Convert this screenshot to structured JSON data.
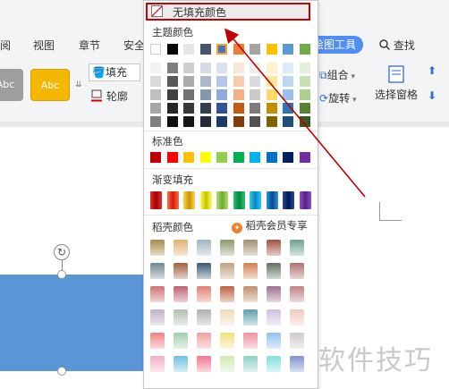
{
  "ribbon": {
    "tabs": [
      "阅",
      "视图",
      "章节",
      "安全"
    ],
    "tool_tab": "绘图工具",
    "search": "查找",
    "style_swatches": [
      {
        "label": "Abc",
        "color": "#9e9e9e"
      },
      {
        "label": "Abc",
        "color": "#f5b800"
      }
    ],
    "fill_label": "填充",
    "outline_label": "轮廓",
    "group_label": "组合",
    "rotate_label": "旋转",
    "select_pane_label": "选择窗格",
    "accent": "#4f8df9"
  },
  "dropdown": {
    "no_fill": "无填充颜色",
    "theme_colors_title": "主题颜色",
    "standard_colors_title": "标准色",
    "gradient_fill_title": "渐变填充",
    "daoke_colors_title": "稻壳颜色",
    "member_label": "稻壳会员专享",
    "theme_top": [
      "#ffffff",
      "#000000",
      "#e7e6e6",
      "#44546a",
      "#4472c4",
      "#ed7d31",
      "#a5a5a5",
      "#ffc000",
      "#5b9bd5",
      "#70ad47"
    ],
    "theme_shades": [
      [
        "#f2f2f2",
        "#7f7f7f",
        "#d0cece",
        "#d6dce4",
        "#d9e1f2",
        "#fbe5d6",
        "#ededed",
        "#fff2cc",
        "#ddebf7",
        "#e2efda"
      ],
      [
        "#d9d9d9",
        "#595959",
        "#aeaaaa",
        "#adb9ca",
        "#b4c6e7",
        "#f8cbad",
        "#dbdbdb",
        "#ffe699",
        "#bdd7ee",
        "#c6e0b4"
      ],
      [
        "#bfbfbf",
        "#404040",
        "#757171",
        "#8497b0",
        "#8ea9db",
        "#f4b084",
        "#c9c9c9",
        "#ffd966",
        "#9bc2e6",
        "#a9d08e"
      ],
      [
        "#a6a6a6",
        "#262626",
        "#3a3838",
        "#333f4f",
        "#2f5597",
        "#c55a11",
        "#7b7b7b",
        "#bf8f00",
        "#2e75b6",
        "#548235"
      ],
      [
        "#808080",
        "#0d0d0d",
        "#171616",
        "#222a35",
        "#1f3864",
        "#833c0b",
        "#525252",
        "#7f6000",
        "#1f4e78",
        "#375623"
      ]
    ],
    "standard": [
      "#c00000",
      "#ff0000",
      "#ffc000",
      "#ffff00",
      "#92d050",
      "#00b050",
      "#00b0f0",
      "#0070c0",
      "#002060",
      "#7030a0"
    ],
    "gradients": [
      [
        "#e03030",
        "#a00000"
      ],
      [
        "#ff6a4a",
        "#d02000"
      ],
      [
        "#ffd24a",
        "#d09000"
      ],
      [
        "#ffff60",
        "#c8c000"
      ],
      [
        "#b0e070",
        "#70a830"
      ],
      [
        "#30c070",
        "#008840"
      ],
      [
        "#30c8f8",
        "#0088c0"
      ],
      [
        "#3090e0",
        "#004c90"
      ],
      [
        "#2a4a90",
        "#001850"
      ],
      [
        "#9050c8",
        "#50208a"
      ]
    ],
    "textures": [
      [
        "#a88a4a",
        "#e0b070",
        "#9fb4c4",
        "#8a9a6a",
        "#a09070",
        "#a05040",
        "#70a090"
      ],
      [
        "#708890",
        "#a06040",
        "#3a5a70",
        "#c0a080",
        "#d08050",
        "#607060",
        "#b07070"
      ],
      [
        "#d07070",
        "#c06070",
        "#e08070",
        "#c06040",
        "#c09070",
        "#a07090",
        "#c08080"
      ],
      [
        "#c0b0c8",
        "#b0c0b0",
        "#b0b0b0",
        "#f0d8c0",
        "#60a0b0",
        "#d0c0e0",
        "#f0c8c0"
      ],
      [
        "#f08080",
        "#a0d0b0",
        "#f0a0a0",
        "#f0e080",
        "#f090a0",
        "#90c0f0",
        "#d0c8d0"
      ],
      [
        "#f0b0c0",
        "#70c0e0",
        "#f07890",
        "#d0e8b0",
        "#90d0c8",
        "#80e0e0",
        "#8090d0"
      ]
    ]
  }
}
